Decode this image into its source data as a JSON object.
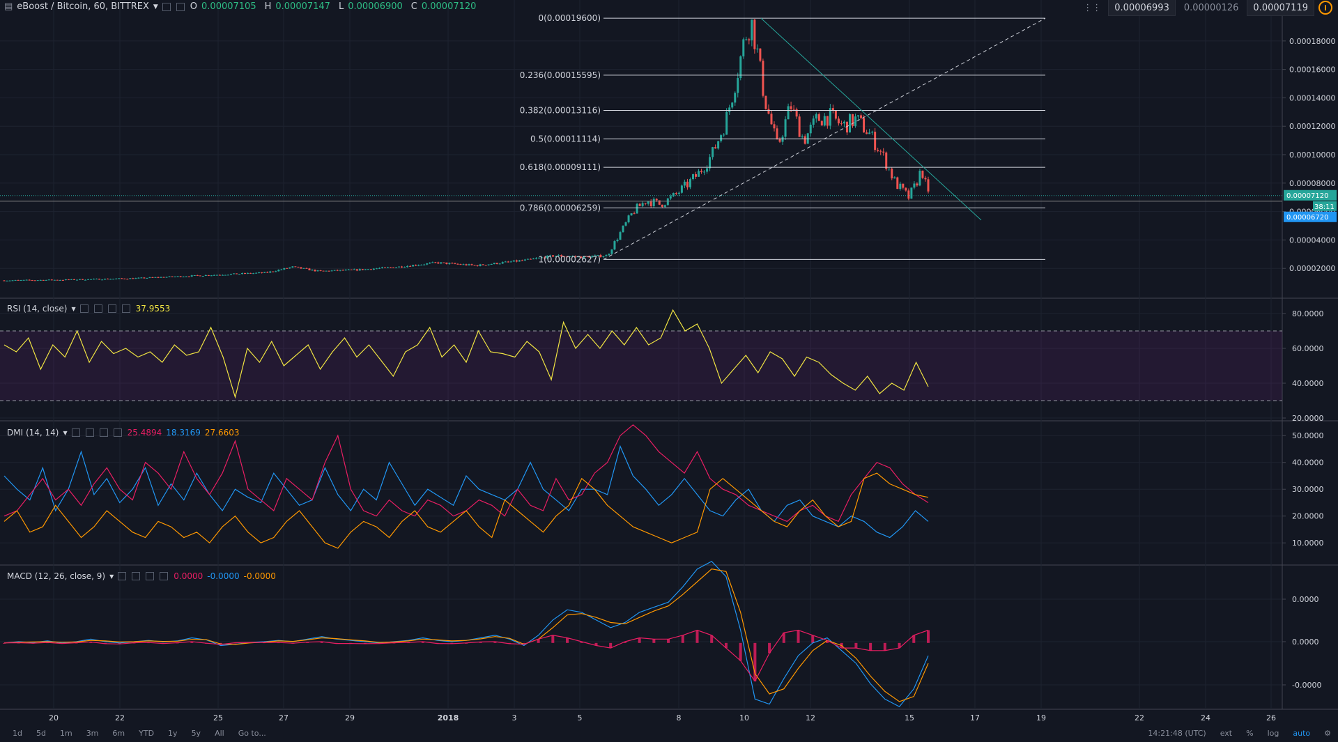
{
  "header": {
    "symbol": "eBoost / Bitcoin, 60, BITTREX",
    "open_label": "O",
    "open": "0.00007105",
    "high_label": "H",
    "high": "0.00007147",
    "low_label": "L",
    "low": "0.00006900",
    "close_label": "C",
    "close": "0.00007120"
  },
  "top_right": {
    "bid": "0.00006993",
    "spread": "0.00000126",
    "ask": "0.00007119"
  },
  "indicators": {
    "rsi": {
      "label": "RSI (14, close)",
      "value": "37.9553",
      "value_color": "#f0e442"
    },
    "dmi": {
      "label": "DMI (14, 14)",
      "v1": "25.4894",
      "v2": "18.3169",
      "v3": "27.6603"
    },
    "macd": {
      "label": "MACD (12, 26, close, 9)",
      "v1": "0.0000",
      "v2": "-0.0000",
      "v3": "-0.0000"
    }
  },
  "price_tags": {
    "last": "0.00007120",
    "countdown": "38:11",
    "other": "0.00006720"
  },
  "toolbar": {
    "ranges": [
      "1d",
      "5d",
      "1m",
      "3m",
      "6m",
      "YTD",
      "1y",
      "5y",
      "All"
    ],
    "goto": "Go to...",
    "time": "14:21:48 (UTC)",
    "ext": "ext",
    "percent": "%",
    "log": "log",
    "auto": "auto"
  },
  "colors": {
    "background": "#131722",
    "up": "#26a69a",
    "down": "#ef5350",
    "rsi": "#f0e442",
    "dmi_plus": "#2196f3",
    "dmi_minus": "#e91e63",
    "adx": "#ff9800",
    "macd": "#2196f3",
    "signal": "#ff9800",
    "hist": "#e91e63",
    "trendline": "#26a69a"
  },
  "chart_data": [
    {
      "type": "candlestick",
      "title": "eBoost / Bitcoin, 60, BITTREX",
      "x_tick_labels": [
        "20",
        "22",
        "25",
        "27",
        "29",
        "2018",
        "3",
        "5",
        "8",
        "10",
        "12",
        "15",
        "17",
        "19",
        "22",
        "24",
        "26"
      ],
      "y_tick_labels": [
        "0.00018000",
        "0.00016000",
        "0.00014000",
        "0.00012000",
        "0.00010000",
        "0.00008000",
        "0.00006000",
        "0.00004000",
        "0.00002000"
      ],
      "ylim": [
        5e-07,
        0.0002
      ],
      "close_path": [
        [
          0,
          1.15e-05
        ],
        [
          5,
          1.2e-05
        ],
        [
          10,
          1.3e-05
        ],
        [
          15,
          1.5e-05
        ],
        [
          20,
          1.7e-05
        ],
        [
          22,
          2.1e-05
        ],
        [
          24,
          1.8e-05
        ],
        [
          27,
          1.9e-05
        ],
        [
          30,
          2.1e-05
        ],
        [
          33,
          2.4e-05
        ],
        [
          36,
          2.2e-05
        ],
        [
          40,
          2.6e-05
        ],
        [
          42,
          2.9e-05
        ],
        [
          44,
          2.8e-05
        ],
        [
          46,
          2.9e-05
        ],
        [
          47,
          4.5e-05
        ],
        [
          48,
          6e-05
        ],
        [
          49,
          6.8e-05
        ],
        [
          50,
          6.5e-05
        ],
        [
          51,
          7e-05
        ],
        [
          52,
          7.8e-05
        ],
        [
          53,
          8.7e-05
        ],
        [
          54,
          0.0001
        ],
        [
          55,
          0.000122
        ],
        [
          55.5,
          0.00014
        ],
        [
          56,
          0.00016
        ],
        [
          56.5,
          0.000182
        ],
        [
          57,
          0.000194
        ],
        [
          57.5,
          0.00017
        ],
        [
          58,
          0.00014
        ],
        [
          59,
          0.000105
        ],
        [
          60,
          0.000135
        ],
        [
          61,
          0.00011
        ],
        [
          62,
          0.000125
        ],
        [
          63,
          0.000127
        ],
        [
          64,
          0.00012
        ],
        [
          65,
          0.000125
        ],
        [
          66,
          0.000115
        ],
        [
          67,
          0.0001
        ],
        [
          68,
          8e-05
        ],
        [
          69,
          7e-05
        ],
        [
          69.5,
          7.8e-05
        ],
        [
          70,
          9e-05
        ],
        [
          70.5,
          7.12e-05
        ]
      ],
      "fibonacci": [
        {
          "label": "0(0.00019600)",
          "level": 0.000196
        },
        {
          "label": "0.236(0.00015595)",
          "level": 0.00015595
        },
        {
          "label": "0.382(0.00013116)",
          "level": 0.00013116
        },
        {
          "label": "0.5(0.00011114)",
          "level": 0.00011114
        },
        {
          "label": "0.618(0.00009111)",
          "level": 9.111e-05
        },
        {
          "label": "0.786(0.00006259)",
          "level": 6.259e-05
        },
        {
          "label": "1(0.00002627)",
          "level": 2.627e-05
        }
      ]
    },
    {
      "type": "line",
      "title": "RSI (14, close)",
      "y_tick_labels": [
        "80.0000",
        "60.0000",
        "40.0000",
        "20.0000"
      ],
      "ylim": [
        20,
        88
      ],
      "bands": [
        30,
        70
      ],
      "series": [
        {
          "name": "RSI",
          "values": [
            62,
            58,
            66,
            48,
            62,
            55,
            70,
            52,
            64,
            57,
            60,
            55,
            58,
            52,
            62,
            56,
            58,
            72,
            55,
            32,
            60,
            52,
            64,
            50,
            56,
            62,
            48,
            58,
            66,
            55,
            62,
            53,
            44,
            58,
            62,
            72,
            55,
            62,
            52,
            70,
            58,
            57,
            55,
            64,
            58,
            42,
            75,
            60,
            68,
            60,
            70,
            62,
            72,
            62,
            66,
            82,
            70,
            74,
            60,
            40,
            48,
            56,
            46,
            58,
            54,
            44,
            55,
            52,
            45,
            40,
            36,
            44,
            34,
            40,
            36,
            52,
            38
          ]
        }
      ]
    },
    {
      "type": "line",
      "title": "DMI (14, 14)",
      "y_tick_labels": [
        "50.0000",
        "40.0000",
        "30.0000",
        "20.0000",
        "10.0000"
      ],
      "ylim": [
        2,
        55
      ],
      "series": [
        {
          "name": "",
          "values": [
            35,
            30,
            26,
            38,
            22,
            30,
            44,
            28,
            34,
            25,
            30,
            38,
            24,
            32,
            26,
            36,
            28,
            22,
            30,
            27,
            25,
            36,
            30,
            24,
            26,
            38,
            28,
            22,
            30,
            26,
            40,
            32,
            24,
            30,
            27,
            24,
            35,
            30,
            28,
            26,
            30,
            40,
            30,
            26,
            22,
            30,
            30,
            28,
            46,
            35,
            30,
            24,
            28,
            34,
            28,
            22,
            20,
            26,
            30,
            22,
            18,
            24,
            26,
            20,
            18,
            16,
            20,
            18,
            14,
            12,
            16,
            22,
            18
          ]
        },
        {
          "name": "",
          "values": [
            20,
            22,
            28,
            34,
            26,
            30,
            24,
            32,
            38,
            30,
            26,
            40,
            36,
            30,
            44,
            34,
            28,
            36,
            48,
            30,
            26,
            22,
            34,
            30,
            26,
            40,
            50,
            30,
            22,
            20,
            26,
            22,
            20,
            26,
            24,
            20,
            22,
            26,
            24,
            20,
            30,
            24,
            22,
            34,
            26,
            28,
            36,
            40,
            50,
            54,
            50,
            44,
            40,
            36,
            44,
            34,
            30,
            28,
            24,
            22,
            20,
            18,
            22,
            24,
            20,
            18,
            28,
            34,
            40,
            38,
            32,
            28,
            25
          ]
        },
        {
          "name": "",
          "values": [
            18,
            22,
            14,
            16,
            24,
            18,
            12,
            16,
            22,
            18,
            14,
            12,
            18,
            16,
            12,
            14,
            10,
            16,
            20,
            14,
            10,
            12,
            18,
            22,
            16,
            10,
            8,
            14,
            18,
            16,
            12,
            18,
            22,
            16,
            14,
            18,
            22,
            16,
            12,
            26,
            22,
            18,
            14,
            20,
            24,
            34,
            30,
            24,
            20,
            16,
            14,
            12,
            10,
            12,
            14,
            30,
            34,
            30,
            26,
            22,
            18,
            16,
            22,
            26,
            20,
            16,
            18,
            34,
            36,
            32,
            30,
            28,
            27
          ]
        }
      ]
    },
    {
      "type": "line",
      "title": "MACD (12, 26, close, 9)",
      "y_tick_labels": [
        "0.0000",
        "0.0000",
        "-0.0000"
      ],
      "ylim": [
        -2.6,
        3
      ],
      "series": [
        {
          "name": "",
          "values": [
            0,
            0.05,
            0.02,
            0.08,
            0,
            0.05,
            0.15,
            0.05,
            0,
            0.05,
            0.1,
            0.04,
            0.08,
            0.2,
            0.12,
            -0.1,
            -0.05,
            0.02,
            0.05,
            0.1,
            0.05,
            0.15,
            0.25,
            0.15,
            0.1,
            0.05,
            0,
            0.05,
            0.1,
            0.2,
            0.1,
            0.05,
            0.1,
            0.2,
            0.3,
            0.15,
            -0.1,
            0.3,
            0.9,
            1.3,
            1.2,
            0.9,
            0.6,
            0.8,
            1.2,
            1.4,
            1.6,
            2.2,
            2.9,
            3.2,
            2.6,
            0.5,
            -2.2,
            -2.4,
            -1.4,
            -0.5,
            0,
            0.2,
            -0.3,
            -0.8,
            -1.6,
            -2.2,
            -2.5,
            -1.8,
            -0.5
          ]
        },
        {
          "name": "",
          "values": [
            0,
            0.03,
            0.04,
            0.05,
            0.03,
            0.04,
            0.1,
            0.08,
            0.04,
            0.05,
            0.08,
            0.06,
            0.07,
            0.14,
            0.13,
            -0.04,
            -0.06,
            0,
            0.03,
            0.08,
            0.06,
            0.12,
            0.2,
            0.17,
            0.12,
            0.08,
            0.02,
            0.04,
            0.08,
            0.15,
            0.12,
            0.08,
            0.1,
            0.16,
            0.25,
            0.18,
            -0.05,
            0.15,
            0.6,
            1.1,
            1.15,
            1,
            0.8,
            0.75,
            1,
            1.25,
            1.45,
            1.9,
            2.4,
            2.9,
            2.8,
            1.2,
            -1.2,
            -2,
            -1.8,
            -1,
            -0.3,
            0.1,
            -0.1,
            -0.6,
            -1.3,
            -1.9,
            -2.3,
            -2.1,
            -0.8
          ]
        },
        {
          "name": "",
          "values": [
            0,
            0.01,
            -0.01,
            0.02,
            -0.02,
            0.01,
            0.04,
            -0.03,
            -0.04,
            0.01,
            0.02,
            -0.02,
            0.01,
            0.05,
            -0.01,
            -0.06,
            0.01,
            0.02,
            0.02,
            0.02,
            -0.01,
            0.03,
            0.05,
            -0.02,
            -0.02,
            -0.03,
            -0.02,
            0.01,
            0.02,
            0.05,
            -0.02,
            -0.03,
            0,
            0.04,
            0.05,
            -0.03,
            -0.05,
            0.15,
            0.3,
            0.2,
            0.05,
            -0.1,
            -0.2,
            0.05,
            0.2,
            0.15,
            0.15,
            0.3,
            0.5,
            0.3,
            -0.2,
            -0.7,
            -1.5,
            -0.4,
            0.4,
            0.5,
            0.3,
            0.1,
            -0.2,
            -0.2,
            -0.3,
            -0.3,
            -0.2,
            0.3,
            0.5
          ]
        }
      ]
    }
  ]
}
